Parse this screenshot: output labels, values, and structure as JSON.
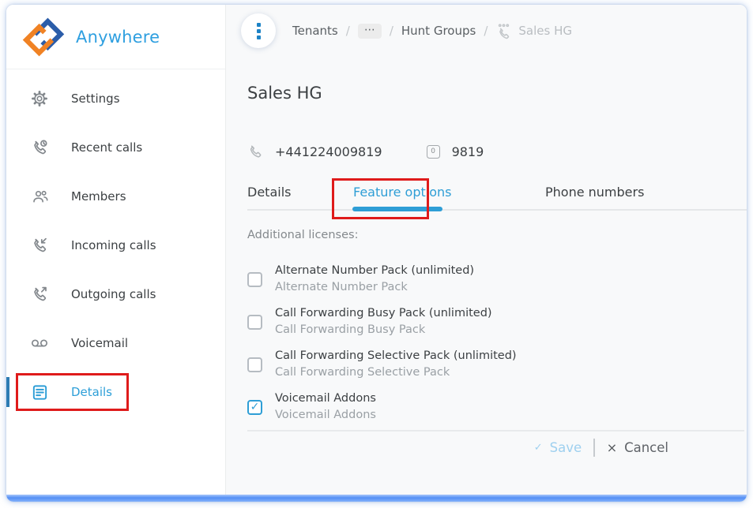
{
  "app": {
    "title": "Anywhere"
  },
  "colors": {
    "accent_blue": "#2e9ed6",
    "brand_text_blue": "#2e9fe0",
    "logo_dark_blue": "#2b5da9",
    "logo_orange": "#f08224",
    "active_sidebar_bar": "#2d7cb3",
    "annotation_red": "#df1b1b",
    "bottom_bar_blue": "#548ff5",
    "save_disabled_blue": "#9ed0ef"
  },
  "sidebar": {
    "items": [
      {
        "label": "Settings",
        "icon": "gear-icon"
      },
      {
        "label": "Recent calls",
        "icon": "recent-calls-icon"
      },
      {
        "label": "Members",
        "icon": "members-icon"
      },
      {
        "label": "Incoming calls",
        "icon": "incoming-calls-icon"
      },
      {
        "label": "Outgoing calls",
        "icon": "outgoing-calls-icon"
      },
      {
        "label": "Voicemail",
        "icon": "voicemail-icon"
      },
      {
        "label": "Details",
        "icon": "details-icon",
        "active": true,
        "annotated": true
      }
    ]
  },
  "header": {
    "menu_icon": "kebab-menu-icon",
    "breadcrumb": {
      "separator": "/",
      "tenants": "Tenants",
      "ellipsis": "⋯",
      "hunt_groups": "Hunt Groups",
      "current": "Sales HG",
      "current_icon": "hunt-group-icon"
    }
  },
  "page": {
    "title": "Sales HG",
    "phone_number": "+441224009819",
    "extension_badge": "0",
    "extension": "9819"
  },
  "tabs": {
    "details": "Details",
    "feature_options": "Feature options",
    "phone_numbers": "Phone numbers",
    "active": "Feature options"
  },
  "feature_options": {
    "section_label": "Additional licenses:",
    "licenses": [
      {
        "label": "Alternate Number Pack (unlimited)",
        "sublabel": "Alternate Number Pack",
        "checked": false
      },
      {
        "label": "Call Forwarding Busy Pack (unlimited)",
        "sublabel": "Call Forwarding Busy Pack",
        "checked": false
      },
      {
        "label": "Call Forwarding Selective Pack (unlimited)",
        "sublabel": "Call Forwarding Selective Pack",
        "checked": false
      },
      {
        "label": "Voicemail Addons",
        "sublabel": "Voicemail Addons",
        "checked": true
      }
    ]
  },
  "footer": {
    "save": "Save",
    "cancel": "Cancel",
    "save_icon_glyph": "✓",
    "cancel_icon_glyph": "×",
    "checkbox_check_glyph": "✓"
  }
}
